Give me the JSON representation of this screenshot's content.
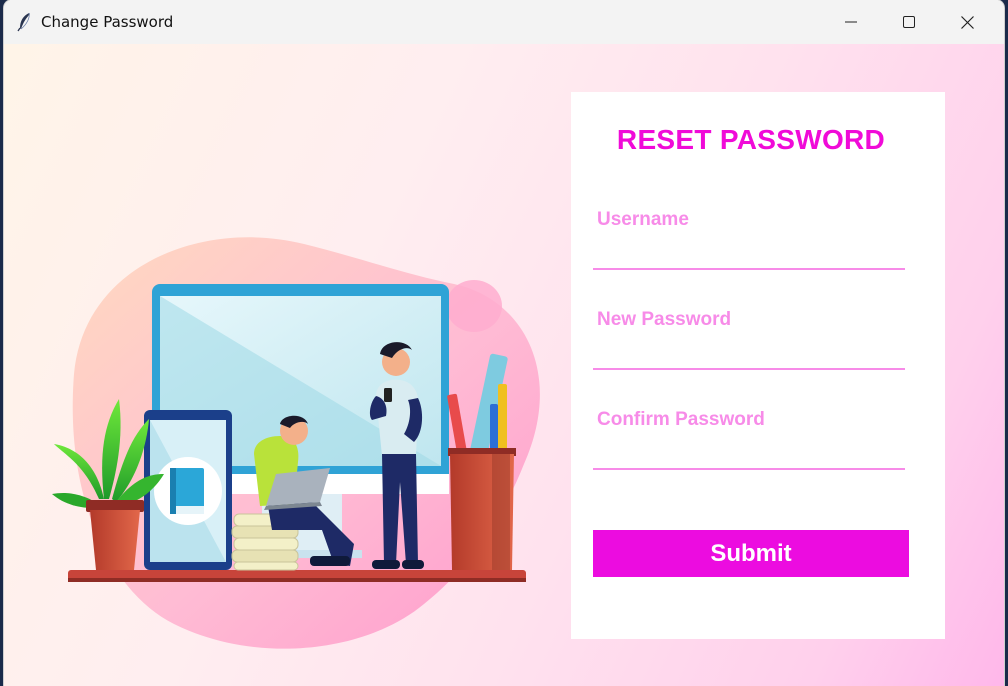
{
  "window": {
    "title": "Change Password",
    "controls": [
      "minimize",
      "maximize",
      "close"
    ]
  },
  "form": {
    "heading": "RESET PASSWORD",
    "fields": [
      {
        "label": "Username",
        "value": ""
      },
      {
        "label": "New Password",
        "value": ""
      },
      {
        "label": "Confirm Password",
        "value": ""
      }
    ],
    "submit_label": "Submit"
  },
  "colors": {
    "accent": "#f00ad8",
    "label": "#f78be8",
    "button": "#ec0ce0",
    "button_text": "#ffffff"
  },
  "illustration": {
    "description_icons": [
      "desktop-monitor-icon",
      "tablet-icon",
      "book-icon",
      "plant-icon",
      "pencil-cup-icon",
      "person-sitting-laptop-icon",
      "person-standing-phone-icon",
      "book-stack-icon"
    ]
  }
}
